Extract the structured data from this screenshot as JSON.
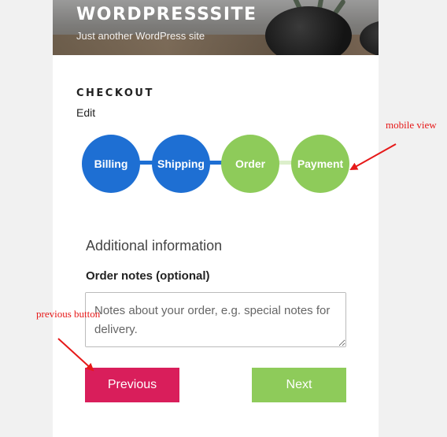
{
  "site": {
    "title": "WORDPRESSSITE",
    "tagline": "Just another WordPress site"
  },
  "page": {
    "title": "CHECKOUT",
    "edit_label": "Edit"
  },
  "steps": [
    {
      "label": "Billing",
      "state": "completed",
      "color": "#1e6fd3"
    },
    {
      "label": "Shipping",
      "state": "completed",
      "color": "#1e6fd3"
    },
    {
      "label": "Order",
      "state": "upcoming",
      "color": "#8ecb5a"
    },
    {
      "label": "Payment",
      "state": "upcoming",
      "color": "#8ecb5a"
    }
  ],
  "form": {
    "section_heading": "Additional information",
    "notes_label": "Order notes (optional)",
    "notes_placeholder": "Notes about your order, e.g. special notes for delivery.",
    "notes_value": ""
  },
  "buttons": {
    "previous_label": "Previous",
    "previous_color": "#d91e5b",
    "next_label": "Next",
    "next_color": "#8ecb5a"
  },
  "annotations": {
    "mobile_view": "mobile view",
    "previous_button": "previous button",
    "color": "#e61919"
  }
}
